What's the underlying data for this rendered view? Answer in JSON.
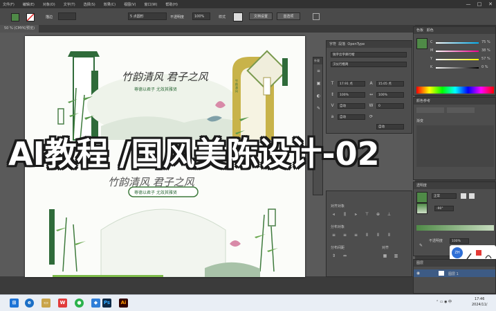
{
  "menubar": {
    "items": [
      "文件(F)",
      "编辑(E)",
      "对象(O)",
      "文字(T)",
      "选择(S)",
      "效果(C)",
      "视图(V)",
      "窗口(W)",
      "帮助(H)"
    ],
    "window_controls": [
      "—",
      "□",
      "✕"
    ]
  },
  "control_bar": {
    "stroke_label": "描边",
    "stroke_weight": "5 点圆形",
    "opacity_label": "不透明度",
    "opacity_value": "100%",
    "style_label": "样式",
    "doc_setup": "文档设置",
    "prefs": "首选项"
  },
  "document_tab": {
    "label": "50 % (CMYK/预览)"
  },
  "artboard": {
    "top_calligraphy": "竹韵清风 君子之风",
    "top_subtitle": "尊德以君子 尤效其雅贤",
    "bottom_calligraphy": "竹韵清风 君子之风",
    "bottom_subtitle": "尊德以君子 尤效其雅贤",
    "right_plaque": "竹韵清风"
  },
  "char_panel": {
    "tabs": [
      "字符",
      "段落",
      "OpenType"
    ],
    "font_name": "锐字云字库行楷",
    "font_style": "汉仪行楷简",
    "size_value": "17.91 点",
    "leading_value": "15.05 点",
    "h_scale": "100%",
    "v_scale": "100%",
    "tracking": "自动",
    "kerning": "0",
    "baseline": "自动",
    "rotate": "自动"
  },
  "left_mini_panel": {
    "label": "外观"
  },
  "align_panel": {
    "title": "对齐对象",
    "distribute_title": "分布对象",
    "spacing_title": "分布间距",
    "align_to": "对齐"
  },
  "color_panel": {
    "tabs": [
      "色板",
      "颜色"
    ],
    "c_label": "C",
    "m_label": "M",
    "y_label": "Y",
    "k_label": "K",
    "c_value": "75 %",
    "m_value": "38 %",
    "y_value": "57 %",
    "k_value": "0 %",
    "fill_color": "#4f8a47"
  },
  "gradient_panel": {
    "title": "颜色参考",
    "subtitle": "渐变"
  },
  "transparency_panel": {
    "title": "透明度",
    "blend_mode": "正常",
    "opacity_label": "不透明度",
    "opacity_value": "100%",
    "angle_value": "-90°"
  },
  "layers_panel": {
    "tab": "图层",
    "layer_name": "图层 1"
  },
  "bottom_widgets": {
    "badge": "ZH"
  },
  "taskbar": {
    "time": "17:46",
    "date": "2024/11/"
  },
  "overlay_title": "AI教程 /国风美陈设计-02"
}
